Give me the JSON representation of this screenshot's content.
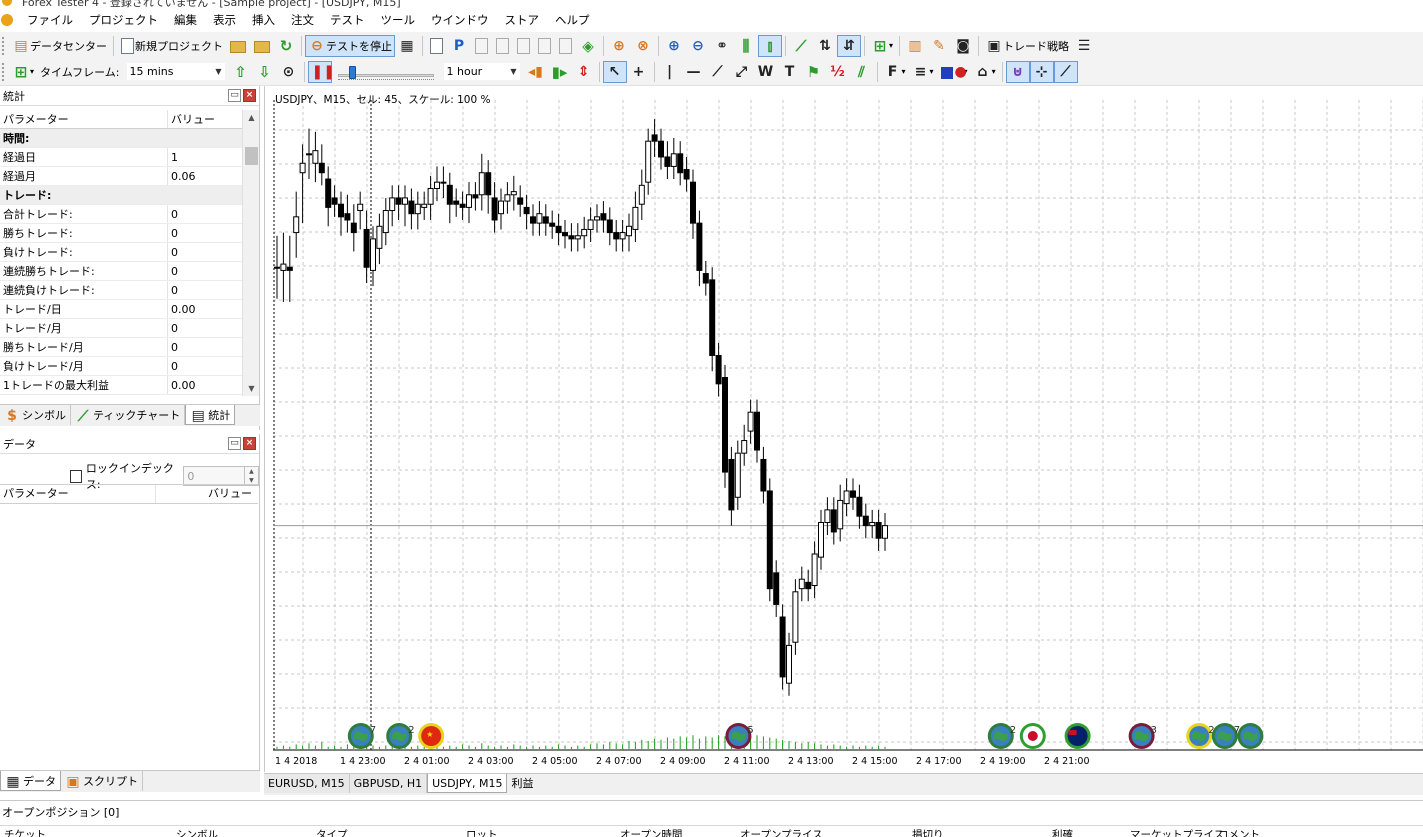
{
  "titlebar": {
    "text": "Forex Tester 4 - 登録されていません - [Sample project] - [USDJPY, M15]"
  },
  "menu": [
    "ファイル",
    "プロジェクト",
    "編集",
    "表示",
    "挿入",
    "注文",
    "テスト",
    "ツール",
    "ウインドウ",
    "ストア",
    "ヘルプ"
  ],
  "toolbar1": {
    "data_center": "データセンター",
    "new_project": "新規プロジェクト",
    "stop_test": "テストを停止",
    "trade_strategy": "トレード戦略"
  },
  "toolbar2": {
    "timeframe_label": "タイムフレーム:",
    "timeframe_value": "15 mins",
    "speed_unit_value": "1 hour",
    "speed_level": 0.12,
    "text_tool": "T",
    "wave_tool": "W",
    "font_tool": "F"
  },
  "stats_panel": {
    "title": "統計",
    "columns": [
      "パラメーター",
      "バリュー"
    ],
    "rows": [
      {
        "name": "時間:",
        "value": "",
        "group": true
      },
      {
        "name": "経過日",
        "value": "1"
      },
      {
        "name": "経過月",
        "value": "0.06"
      },
      {
        "name": "トレード:",
        "value": "",
        "group": true
      },
      {
        "name": "合計トレード:",
        "value": "0"
      },
      {
        "name": "勝ちトレード:",
        "value": "0"
      },
      {
        "name": "負けトレード:",
        "value": "0"
      },
      {
        "name": "連続勝ちトレード:",
        "value": "0"
      },
      {
        "name": "連続負けトレード:",
        "value": "0"
      },
      {
        "name": "トレード/日",
        "value": "0.00"
      },
      {
        "name": "トレード/月",
        "value": "0"
      },
      {
        "name": "勝ちトレード/月",
        "value": "0"
      },
      {
        "name": "負けトレード/月",
        "value": "0"
      },
      {
        "name": "1トレードの最大利益",
        "value": "0.00"
      }
    ],
    "tabs": [
      "シンボル",
      "ティックチャート",
      "統計"
    ],
    "active_tab": 2
  },
  "data_panel": {
    "title": "データ",
    "lock_index_label": "ロックインデックス:",
    "lock_index_value": "0",
    "columns": [
      "パラメーター",
      "バリュー"
    ],
    "tabs": [
      "データ",
      "スクリプト"
    ]
  },
  "chart": {
    "info": "USDJPY、M15、セル: 45、スケール: 100 %",
    "tabs": [
      "EURUSD, M15",
      "GBPUSD, H1",
      "USDJPY, M15",
      "利益"
    ],
    "active_tab": 2,
    "colors": {
      "up": "#ffffff",
      "down": "#000000",
      "volume": "#1a9a1a",
      "grid": "#c8c8c8"
    }
  },
  "chart_data": {
    "type": "candlestick",
    "symbol": "USDJPY",
    "timeframe": "M15",
    "x_ticks": [
      "1 4 2018",
      "1 4 23:00",
      "2 4 01:00",
      "2 4 03:00",
      "2 4 05:00",
      "2 4 07:00",
      "2 4 09:00",
      "2 4 11:00",
      "2 4 13:00",
      "2 4 15:00",
      "2 4 17:00",
      "2 4 19:00",
      "2 4 21:00"
    ],
    "candles": [
      [
        0.0,
        0.0,
        -10,
        10
      ],
      [
        -0.5,
        0.5,
        -10,
        10
      ],
      [
        0.0,
        -0.5,
        -10,
        10
      ],
      [
        5.5,
        8.0,
        -8,
        8
      ],
      [
        15.0,
        16.5,
        -16,
        6
      ],
      [
        18.0,
        18.0,
        -8,
        8
      ],
      [
        16.5,
        18.5,
        -6,
        6
      ],
      [
        16.5,
        15.0,
        -4,
        6
      ],
      [
        14.0,
        9.5,
        -6,
        4
      ],
      [
        11.0,
        10.0,
        -4,
        4
      ],
      [
        10.0,
        8.0,
        -6,
        4
      ],
      [
        8.5,
        7.5,
        -4,
        6
      ],
      [
        7.0,
        5.5,
        -6,
        6
      ],
      [
        9.0,
        10.0,
        -6,
        4
      ],
      [
        6.0,
        0.0,
        -5,
        6
      ],
      [
        -0.5,
        4.5,
        -5,
        4
      ],
      [
        3.0,
        6.5,
        -5,
        4
      ],
      [
        5.5,
        9.0,
        -4,
        4
      ],
      [
        9.0,
        11.0,
        -5,
        4
      ],
      [
        11.0,
        10.0,
        -5,
        4
      ],
      [
        10.0,
        11.0,
        -7,
        4
      ],
      [
        10.5,
        8.5,
        -5,
        4
      ],
      [
        8.5,
        10.0,
        -5,
        4
      ],
      [
        9.5,
        10.0,
        -4,
        4
      ],
      [
        10.0,
        12.5,
        -5,
        4
      ],
      [
        12.5,
        13.5,
        -4,
        5
      ],
      [
        13.5,
        13.5,
        -5,
        5
      ],
      [
        13.0,
        10.0,
        -6,
        4
      ],
      [
        10.5,
        10.0,
        -4,
        4
      ],
      [
        10.0,
        9.5,
        -4,
        4
      ],
      [
        9.5,
        11.5,
        -5,
        4
      ],
      [
        11.5,
        11.0,
        -4,
        4
      ],
      [
        11.5,
        15.0,
        -5,
        6
      ],
      [
        15.0,
        11.5,
        -6,
        4
      ],
      [
        11.0,
        7.5,
        -4,
        5
      ],
      [
        8.5,
        10.5,
        -5,
        4
      ],
      [
        10.5,
        11.5,
        -4,
        4
      ],
      [
        11.5,
        12.0,
        -5,
        5
      ],
      [
        11.0,
        10.0,
        -4,
        4
      ],
      [
        9.5,
        8.5,
        -5,
        4
      ],
      [
        8.0,
        7.0,
        -4,
        4
      ],
      [
        7.0,
        8.5,
        -4,
        4
      ],
      [
        8.0,
        7.0,
        -4,
        4
      ],
      [
        7.0,
        6.5,
        -4,
        4
      ],
      [
        6.5,
        5.5,
        -4,
        4
      ],
      [
        5.5,
        5.0,
        -4,
        4
      ],
      [
        5.0,
        4.5,
        -4,
        4
      ],
      [
        4.5,
        5.0,
        -4,
        4
      ],
      [
        5.0,
        6.0,
        -4,
        4
      ],
      [
        6.0,
        7.5,
        -4,
        4
      ],
      [
        7.5,
        8.0,
        -4,
        4
      ],
      [
        8.5,
        7.5,
        -4,
        4
      ],
      [
        7.5,
        5.5,
        -4,
        4
      ],
      [
        5.5,
        4.5,
        -4,
        4
      ],
      [
        4.5,
        5.5,
        -4,
        4
      ],
      [
        5.0,
        6.5,
        -5,
        4
      ],
      [
        6.0,
        9.5,
        -4,
        5
      ],
      [
        10.0,
        13.0,
        -5,
        5
      ],
      [
        13.5,
        20.0,
        -4,
        4
      ],
      [
        21.0,
        20.0,
        -5,
        5
      ],
      [
        20.0,
        17.5,
        -4,
        4
      ],
      [
        17.5,
        16.0,
        -4,
        5
      ],
      [
        16.0,
        18.0,
        -4,
        5
      ],
      [
        18.0,
        15.0,
        -4,
        4
      ],
      [
        15.5,
        14.0,
        -4,
        4
      ],
      [
        13.5,
        7.0,
        -5,
        4
      ],
      [
        7.0,
        -0.5,
        -5,
        4
      ],
      [
        -1.0,
        -2.5,
        -4,
        4
      ],
      [
        -2.0,
        -14.0,
        -5,
        4
      ],
      [
        -14.0,
        -18.5,
        -4,
        4
      ],
      [
        -17.5,
        -32.5,
        -5,
        4
      ],
      [
        -30.5,
        -38.5,
        -5,
        4
      ],
      [
        -36.5,
        -29.5,
        -4,
        4
      ],
      [
        -29.5,
        -27.5,
        -4,
        5
      ],
      [
        -26.0,
        -23.0,
        -4,
        4
      ],
      [
        -23.0,
        -29.0,
        -4,
        4
      ],
      [
        -30.5,
        -35.5,
        -4,
        4
      ],
      [
        -35.5,
        -51.0,
        -4,
        4
      ],
      [
        -48.5,
        -53.5,
        -4,
        4
      ],
      [
        -55.5,
        -65.0,
        -4,
        4
      ],
      [
        -66.0,
        -60.0,
        -4,
        4
      ],
      [
        -59.5,
        -51.5,
        -4,
        4
      ],
      [
        -51.0,
        -49.5,
        -4,
        4
      ],
      [
        -50.0,
        -51.0,
        -4,
        4
      ],
      [
        -50.5,
        -45.5,
        -4,
        4
      ],
      [
        -46.0,
        -40.5,
        -4,
        4
      ],
      [
        -40.5,
        -38.5,
        -4,
        4
      ],
      [
        -38.5,
        -42.0,
        -4,
        4
      ],
      [
        -41.5,
        -37.0,
        -4,
        5
      ],
      [
        -37.5,
        -35.5,
        -4,
        4
      ],
      [
        -35.5,
        -36.5,
        -4,
        4
      ],
      [
        -36.5,
        -39.5,
        -4,
        4
      ],
      [
        -39.5,
        -41.0,
        -4,
        4
      ],
      [
        -41.0,
        -40.5,
        -4,
        4
      ],
      [
        -40.5,
        -43.0,
        -4,
        4
      ],
      [
        -43.0,
        -41.0,
        -4,
        4
      ]
    ],
    "volume": [
      2,
      3,
      2,
      4,
      3,
      5,
      3,
      6,
      2,
      3,
      2,
      4,
      3,
      2,
      5,
      3,
      2,
      3,
      2,
      4,
      3,
      2,
      3,
      2,
      4,
      3,
      2,
      3,
      2,
      4,
      3,
      2,
      5,
      3,
      2,
      3,
      2,
      4,
      3,
      2,
      3,
      2,
      3,
      2,
      4,
      3,
      2,
      3,
      2,
      4,
      5,
      4,
      6,
      5,
      4,
      7,
      6,
      8,
      7,
      9,
      8,
      10,
      9,
      11,
      10,
      12,
      9,
      11,
      10,
      12,
      11,
      13,
      12,
      14,
      13,
      12,
      11,
      10,
      9,
      8,
      7,
      6,
      5,
      6,
      5,
      4,
      3,
      4,
      3,
      2,
      3,
      2,
      3,
      2,
      3,
      2
    ],
    "events": [
      {
        "at": 12,
        "kind": "globe",
        "count": "7"
      },
      {
        "at": 18,
        "kind": "globe",
        "count": "2"
      },
      {
        "at": 23,
        "kind": "china",
        "count": ""
      },
      {
        "at": 71,
        "kind": "globe-red",
        "count": "5"
      },
      {
        "at": 112,
        "kind": "globe",
        "count": "2"
      },
      {
        "at": 117,
        "kind": "japan",
        "count": ""
      },
      {
        "at": 124,
        "kind": "australia",
        "count": ""
      },
      {
        "at": 134,
        "kind": "globe-red",
        "count": "3"
      },
      {
        "at": 143,
        "kind": "globe-yellow",
        "count": "2"
      },
      {
        "at": 147,
        "kind": "globe",
        "count": "7"
      },
      {
        "at": 151,
        "kind": "globe",
        "count": ""
      }
    ]
  },
  "bottom": {
    "title": "オープンポジション [0]",
    "columns": [
      "チケット",
      "シンボル",
      "タイプ",
      "ロット",
      "オープン時間",
      "オープンプライス",
      "損切り",
      "利確",
      "マーケットプライス",
      "コメント"
    ]
  }
}
